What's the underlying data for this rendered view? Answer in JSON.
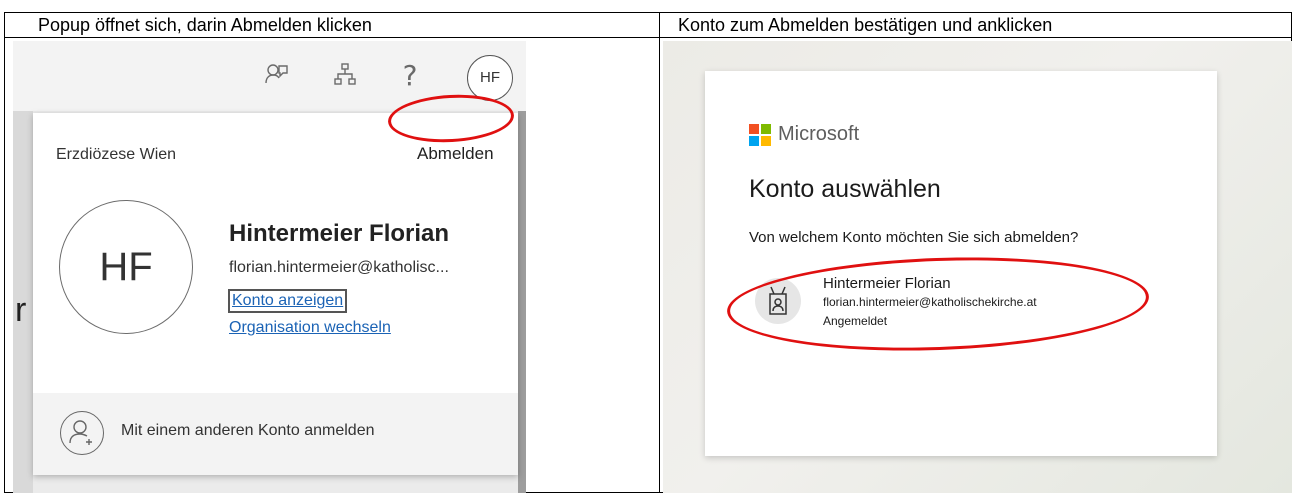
{
  "table": {
    "left_header": "Popup öffnet sich, darin Abmelden klicken",
    "right_header": "Konto zum Abmelden bestätigen und anklicken"
  },
  "left_shot": {
    "topbar_icons": [
      "feedback-icon",
      "org-chart-icon",
      "help-icon"
    ],
    "help_glyph": "?",
    "topbar_avatar_initials": "HF",
    "background_letter": "r",
    "bottom_text": "…",
    "popup": {
      "org_name": "Erzdiözese Wien",
      "signout_label": "Abmelden",
      "avatar_initials": "HF",
      "user_name": "Hintermeier Florian",
      "user_email": "florian.hintermeier@katholisc...",
      "view_account_label": "Konto anzeigen",
      "switch_org_label": "Organisation wechseln",
      "other_account_label": "Mit einem anderen Konto anmelden"
    }
  },
  "right_shot": {
    "brand": "Microsoft",
    "title": "Konto auswählen",
    "question": "Von welchem Konto möchten Sie sich abmelden?",
    "account": {
      "name": "Hintermeier Florian",
      "email": "florian.hintermeier@katholischekirche.at",
      "status": "Angemeldet"
    }
  },
  "colors": {
    "highlight_ring": "#e01010",
    "link": "#1b63b5",
    "ms_red": "#f25022",
    "ms_green": "#7fba00",
    "ms_blue": "#00a4ef",
    "ms_yellow": "#ffb900"
  }
}
